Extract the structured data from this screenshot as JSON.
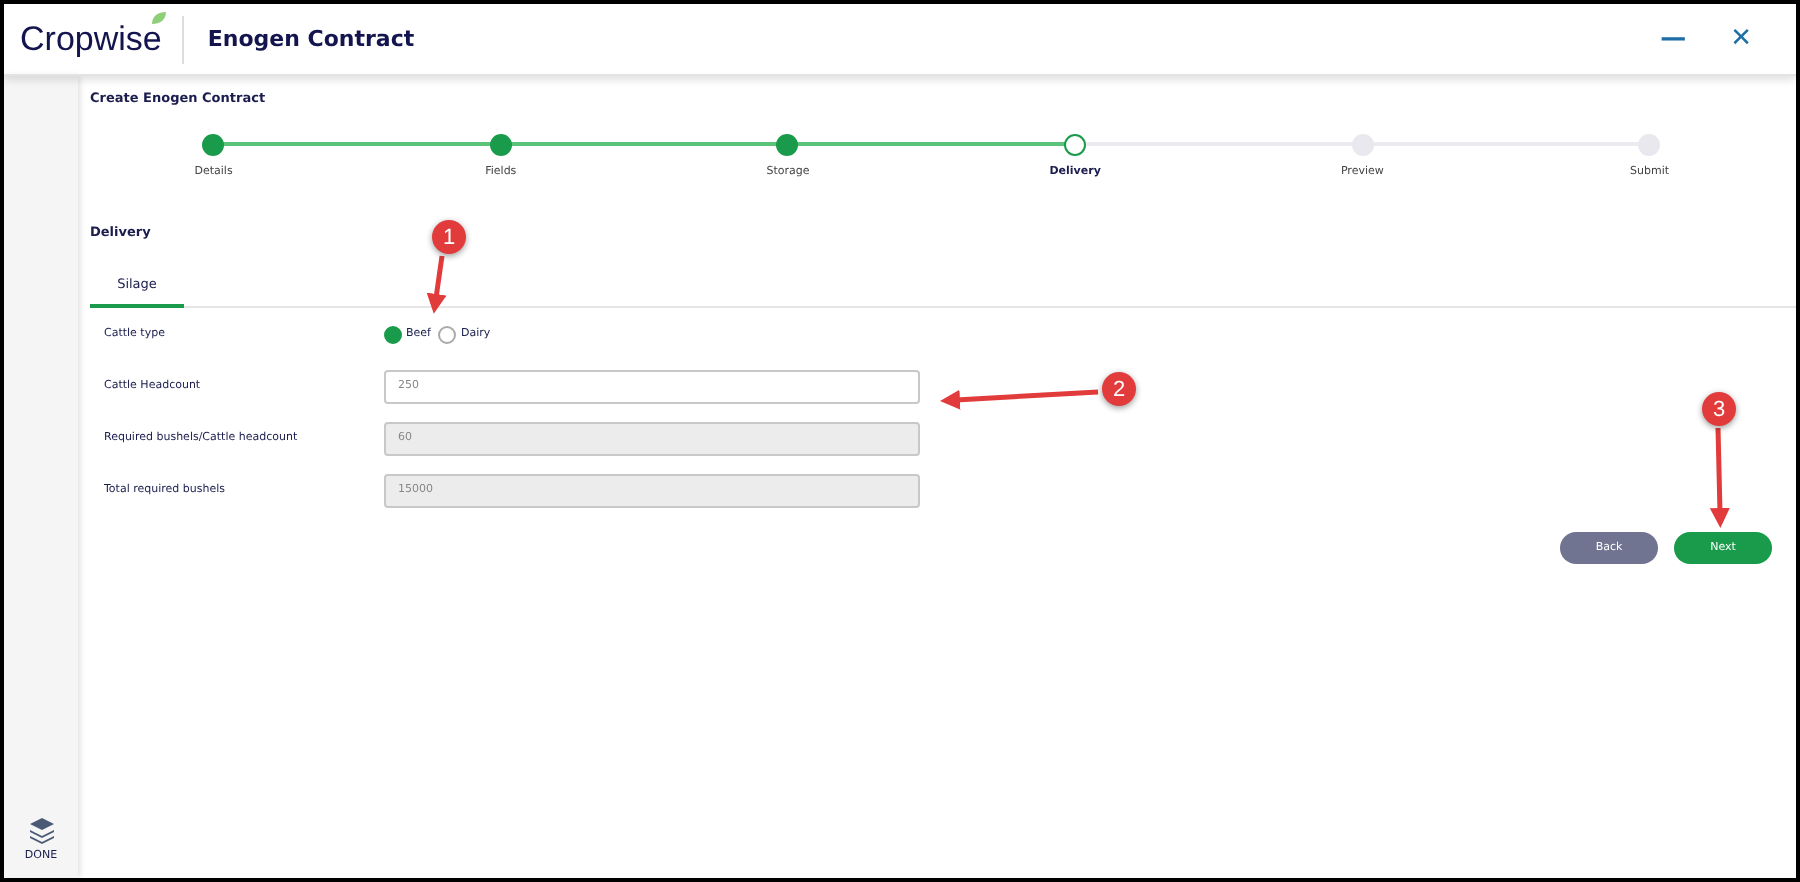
{
  "header": {
    "logo": "Cropwise",
    "title": "Enogen Contract",
    "minimize": "—",
    "close": "✕"
  },
  "sidebar": {
    "done_label": "DONE"
  },
  "page_title": "Create Enogen Contract",
  "steps": [
    {
      "label": "Details",
      "kind": "done"
    },
    {
      "label": "Fields",
      "kind": "done"
    },
    {
      "label": "Storage",
      "kind": "done"
    },
    {
      "label": "Delivery",
      "kind": "current"
    },
    {
      "label": "Preview",
      "kind": "todo"
    },
    {
      "label": "Submit",
      "kind": "todo"
    }
  ],
  "section_title": "Delivery",
  "tabs": [
    {
      "label": "Silage",
      "selected": true
    }
  ],
  "form": {
    "cattle_type": {
      "label": "Cattle type",
      "options": [
        {
          "label": "Beef",
          "selected": true
        },
        {
          "label": "Dairy",
          "selected": false
        }
      ]
    },
    "fields": [
      {
        "label": "Cattle Headcount",
        "value": "250",
        "disabled": false
      },
      {
        "label": "Required bushels/Cattle headcount",
        "value": "60",
        "disabled": true
      },
      {
        "label": "Total required bushels",
        "value": "15000",
        "disabled": true
      }
    ]
  },
  "buttons": [
    {
      "label": "Back",
      "kind": "secondary"
    },
    {
      "label": "Next",
      "kind": "primary"
    }
  ],
  "annotations": [
    {
      "number": "1",
      "kind": "down"
    },
    {
      "number": "2",
      "kind": "left"
    },
    {
      "number": "3",
      "kind": "down"
    }
  ]
}
